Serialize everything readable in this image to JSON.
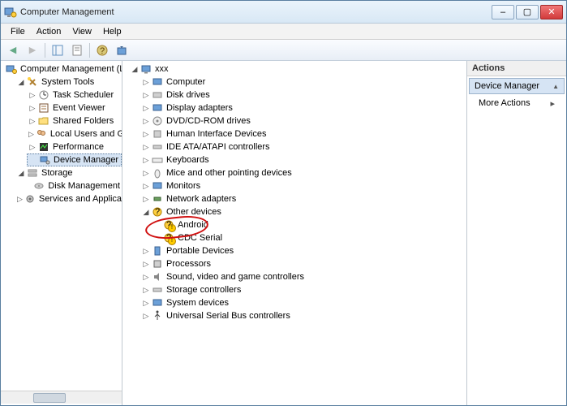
{
  "window": {
    "title": "Computer Management"
  },
  "menu": {
    "file": "File",
    "action": "Action",
    "view": "View",
    "help": "Help"
  },
  "winbtn": {
    "min": "–",
    "max": "▢",
    "close": "✕"
  },
  "left": {
    "root": "Computer Management (Local",
    "systools": "System Tools",
    "task": "Task Scheduler",
    "event": "Event Viewer",
    "shared": "Shared Folders",
    "users": "Local Users and Groups",
    "perf": "Performance",
    "devmgr": "Device Manager",
    "storage": "Storage",
    "diskmgmt": "Disk Management",
    "services": "Services and Applications"
  },
  "mid": {
    "root": "xxx",
    "items": {
      "computer": "Computer",
      "diskdrives": "Disk drives",
      "display": "Display adapters",
      "dvd": "DVD/CD-ROM drives",
      "hid": "Human Interface Devices",
      "ide": "IDE ATA/ATAPI controllers",
      "keyboards": "Keyboards",
      "mice": "Mice and other pointing devices",
      "monitors": "Monitors",
      "network": "Network adapters",
      "other": "Other devices",
      "android": "Android",
      "cdc": "CDC Serial",
      "portable": "Portable Devices",
      "processors": "Processors",
      "sound": "Sound, video and game controllers",
      "storagectl": "Storage controllers",
      "sysdev": "System devices",
      "usb": "Universal Serial Bus controllers"
    }
  },
  "right": {
    "header": "Actions",
    "selected": "Device Manager",
    "more": "More Actions",
    "caret_up": "▲",
    "caret_right": "▸"
  },
  "glyph": {
    "collapsed": "▷",
    "expanded": "◢",
    "back": "◀",
    "fwd": "▶"
  }
}
